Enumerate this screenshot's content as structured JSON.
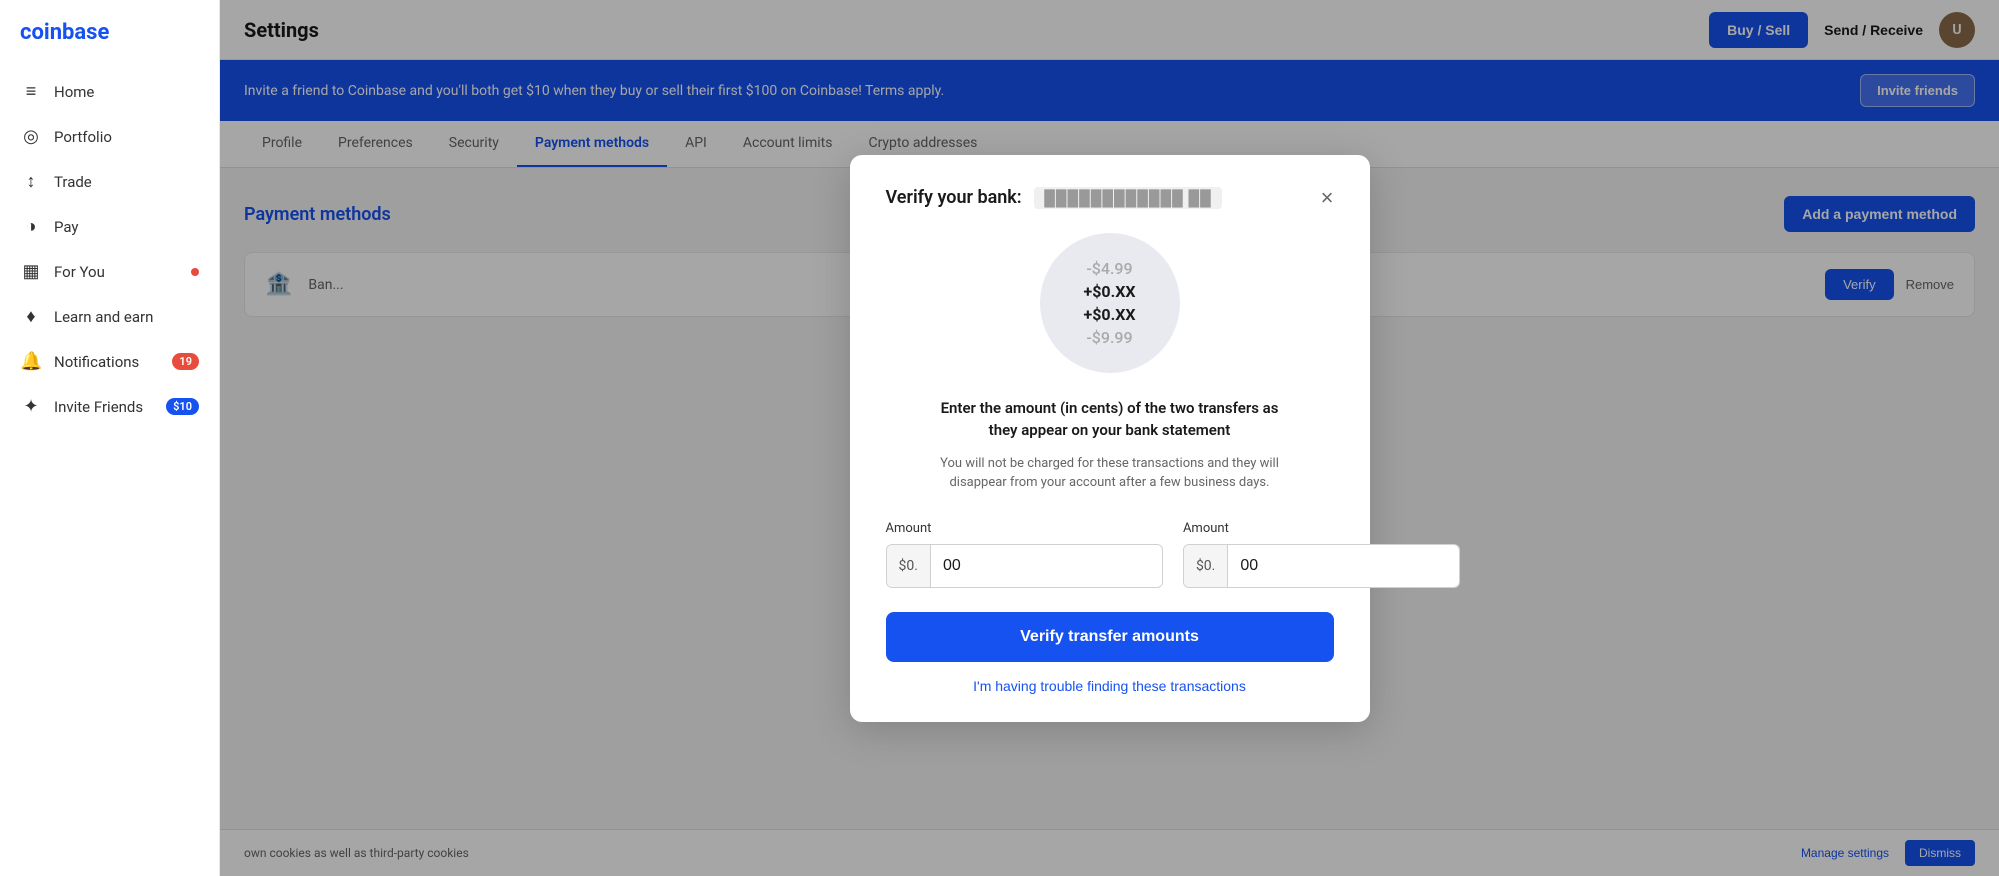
{
  "sidebar": {
    "logo": "coinbase",
    "items": [
      {
        "id": "home",
        "label": "Home",
        "icon": "≡",
        "badge": null,
        "badgeType": null
      },
      {
        "id": "portfolio",
        "label": "Portfolio",
        "icon": "◎",
        "badge": null,
        "badgeType": null
      },
      {
        "id": "trade",
        "label": "Trade",
        "icon": "↕",
        "badge": null,
        "badgeType": null
      },
      {
        "id": "pay",
        "label": "Pay",
        "icon": "◑",
        "badge": null,
        "badgeType": null
      },
      {
        "id": "for-you",
        "label": "For You",
        "icon": "▦",
        "badge": "dot",
        "badgeType": "dot"
      },
      {
        "id": "learn-earn",
        "label": "Learn and earn",
        "icon": "♦",
        "badge": null,
        "badgeType": null
      },
      {
        "id": "notifications",
        "label": "Notifications",
        "icon": "🔔",
        "badge": "19",
        "badgeType": "red"
      },
      {
        "id": "invite-friends",
        "label": "Invite Friends",
        "icon": "✦",
        "badge": "$10",
        "badgeType": "blue"
      }
    ]
  },
  "topbar": {
    "title": "Settings",
    "buy_sell_label": "Buy / Sell",
    "send_receive_label": "Send / Receive"
  },
  "banner": {
    "text": "Invite a friend to Coinbase and you'll both get $10 when they buy or sell their first $100 on Coinbase! Terms apply.",
    "invite_label": "Invite friends"
  },
  "tabs": [
    {
      "id": "profile",
      "label": "Profile",
      "active": false
    },
    {
      "id": "preferences",
      "label": "Preferences",
      "active": false
    },
    {
      "id": "security",
      "label": "Security",
      "active": false
    },
    {
      "id": "payment-methods",
      "label": "Payment methods",
      "active": true
    },
    {
      "id": "api",
      "label": "API",
      "active": false
    },
    {
      "id": "account-limits",
      "label": "Account limits",
      "active": false
    },
    {
      "id": "crypto-addresses",
      "label": "Crypto addresses",
      "active": false
    }
  ],
  "payment_methods": {
    "title": "Payment methods",
    "add_payment_label": "Add a payment method",
    "bank_name_masked": "Ban...",
    "verify_label": "Verify",
    "remove_label": "Remove"
  },
  "cookie_bar": {
    "text": "own cookies as well as third-party cookies",
    "manage_label": "Manage settings",
    "dismiss_label": "Dismiss"
  },
  "modal": {
    "title_prefix": "Verify your bank:",
    "title_bank_masked": "████████████████████ ████",
    "close_icon": "×",
    "transactions": [
      {
        "amount": "-$4.99",
        "type": "negative"
      },
      {
        "amount": "+$0.XX",
        "type": "positive"
      },
      {
        "amount": "+$0.XX",
        "type": "positive"
      },
      {
        "amount": "-$9.99",
        "type": "negative"
      }
    ],
    "description": "Enter the amount (in cents) of the two transfers as\nthey appear on your bank statement",
    "sub_description": "You will not be charged for these transactions and they will\ndisappear from your account after a few business days.",
    "amount1_label": "Amount",
    "amount1_prefix": "$0.",
    "amount1_placeholder": "00",
    "amount2_label": "Amount",
    "amount2_prefix": "$0.",
    "amount2_placeholder": "00",
    "verify_button_label": "Verify transfer amounts",
    "trouble_link": "I'm having trouble finding these transactions"
  }
}
